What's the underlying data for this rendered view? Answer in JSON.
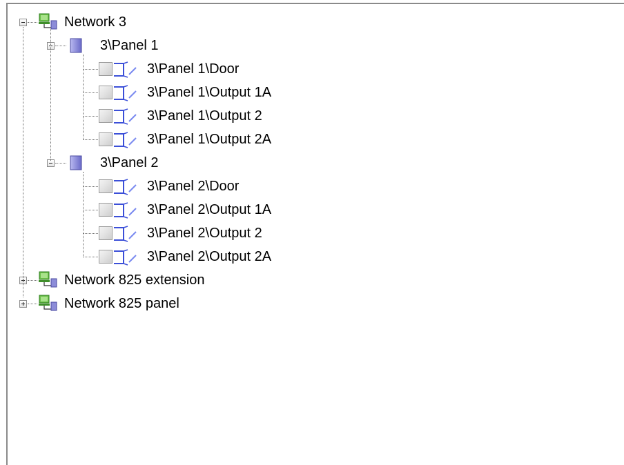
{
  "tree": {
    "networks": [
      {
        "label": "Network 3",
        "expanded": true,
        "panels": [
          {
            "label": "3\\Panel 1",
            "expanded": true,
            "children": [
              "3\\Panel 1\\Door",
              "3\\Panel 1\\Output 1A",
              "3\\Panel 1\\Output 2",
              "3\\Panel 1\\Output 2A"
            ]
          },
          {
            "label": "3\\Panel 2",
            "expanded": true,
            "children": [
              "3\\Panel 2\\Door",
              "3\\Panel 2\\Output 1A",
              "3\\Panel 2\\Output 2",
              "3\\Panel 2\\Output 2A"
            ]
          }
        ]
      },
      {
        "label": "Network 825 extension",
        "expanded": false
      },
      {
        "label": "Network 825 panel",
        "expanded": false
      }
    ]
  },
  "icons": {
    "network": "network-computer-icon",
    "panel": "panel-icon",
    "output": "door-output-icon"
  },
  "colors": {
    "network_green": "#6cc04a",
    "panel_purple": "#8c8cd8",
    "output_blue": "#5a6ee8"
  }
}
